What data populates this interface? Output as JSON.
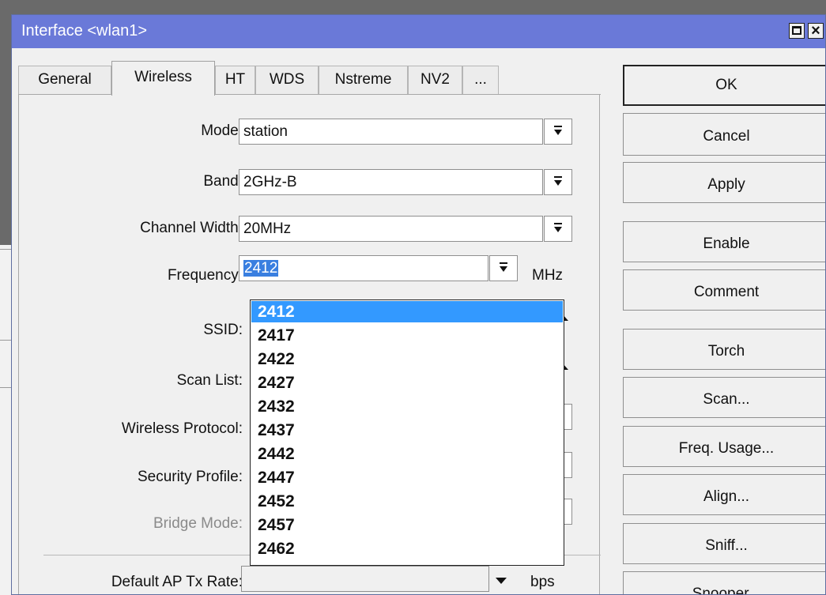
{
  "window": {
    "title": "Interface <wlan1>"
  },
  "tabs": [
    "General",
    "Wireless",
    "HT",
    "WDS",
    "Nstreme",
    "NV2",
    "..."
  ],
  "active_tab": "Wireless",
  "fields": {
    "mode": {
      "label": "Mode:",
      "value": "station"
    },
    "band": {
      "label": "Band:",
      "value": "2GHz-B"
    },
    "channel_width": {
      "label": "Channel Width:",
      "value": "20MHz"
    },
    "frequency": {
      "label": "Frequency:",
      "value": "2412",
      "unit": "MHz"
    },
    "ssid": {
      "label": "SSID:"
    },
    "scan_list": {
      "label": "Scan List:"
    },
    "wireless_protocol": {
      "label": "Wireless Protocol:"
    },
    "security_profile": {
      "label": "Security Profile:"
    },
    "bridge_mode": {
      "label": "Bridge Mode:"
    },
    "default_ap_tx_rate": {
      "label": "Default AP Tx Rate:",
      "value": "",
      "unit": "bps"
    }
  },
  "frequency_options": [
    "2412",
    "2417",
    "2422",
    "2427",
    "2432",
    "2437",
    "2442",
    "2447",
    "2452",
    "2457",
    "2462"
  ],
  "selected_option": "2412",
  "buttons": {
    "ok": "OK",
    "cancel": "Cancel",
    "apply": "Apply",
    "enable": "Enable",
    "comment": "Comment",
    "torch": "Torch",
    "scan": "Scan...",
    "freq_usage": "Freq. Usage...",
    "align": "Align...",
    "sniff": "Sniff...",
    "snooper": "Snooper..."
  },
  "colors": {
    "titlebar": "#6a79d8",
    "selection": "#3399ff"
  }
}
